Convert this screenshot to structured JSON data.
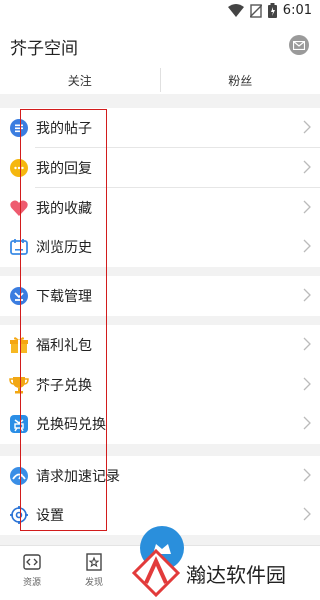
{
  "status_bar": {
    "time": "6:01",
    "icons": [
      "wifi-icon",
      "no-sim-icon",
      "battery-icon"
    ]
  },
  "header": {
    "title": "芥子空间",
    "mail_icon": "mail-icon"
  },
  "tabs": [
    {
      "label": "关注"
    },
    {
      "label": "粉丝"
    }
  ],
  "menu": [
    {
      "label": "我的帖子",
      "icon": "post-icon",
      "color": "#3b7de0"
    },
    {
      "label": "我的回复",
      "icon": "reply-icon",
      "color": "#f5b70f"
    },
    {
      "label": "我的收藏",
      "icon": "heart-icon",
      "color": "#ee5b6f"
    },
    {
      "label": "浏览历史",
      "icon": "history-icon",
      "color": "#3b8be5"
    },
    {
      "label": "下载管理",
      "icon": "download-icon",
      "color": "#3b7de0"
    },
    {
      "label": "福利礼包",
      "icon": "gift-icon",
      "color": "#f7b823"
    },
    {
      "label": "芥子兑换",
      "icon": "trophy-icon",
      "color": "#f2a713"
    },
    {
      "label": "兑换码兑换",
      "icon": "redeem-icon",
      "color": "#2b8ee6"
    },
    {
      "label": "请求加速记录",
      "icon": "speed-icon",
      "color": "#3a8ee6"
    },
    {
      "label": "设置",
      "icon": "settings-icon",
      "color": "#2a73d6"
    }
  ],
  "bottom_nav": [
    {
      "label": "资源",
      "icon": "code-icon"
    },
    {
      "label": "发现",
      "icon": "star-icon"
    }
  ],
  "watermark": {
    "text": "瀚达软件园"
  },
  "colors": {
    "accent": "#2a8fdc",
    "highlight": "#d21c1c",
    "background": "#f2f2f2"
  }
}
